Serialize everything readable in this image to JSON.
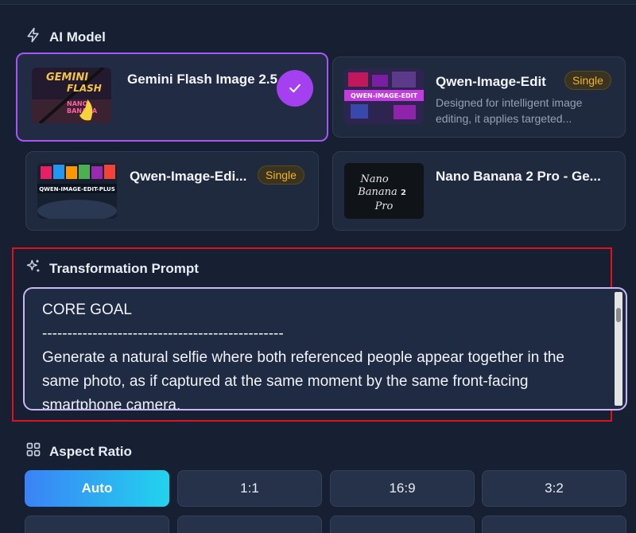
{
  "ai_model": {
    "label": "AI Model",
    "cards": [
      {
        "title": "Gemini Flash Image 2.5",
        "selected": true
      },
      {
        "title": "Qwen-Image-Edit",
        "badge": "Single",
        "description": "Designed for intelligent image editing, it applies targeted..."
      },
      {
        "title": "Qwen-Image-Edi...",
        "badge": "Single"
      },
      {
        "title": "Nano Banana 2 Pro - Ge..."
      }
    ],
    "thumb_texts": {
      "gemini": [
        "GEMINI",
        "FLASH",
        "NANO",
        "BANANA"
      ],
      "qwen_edit": "QWEN-IMAGE-EDIT",
      "qwen_plus": "QWEN-IMAGE-EDIT-PLUS",
      "nano": [
        "Nano",
        "Banana",
        "2",
        "Pro"
      ]
    }
  },
  "prompt": {
    "label": "Transformation Prompt",
    "text": "CORE GOAL\n------------------------------------------------\nGenerate a natural selfie where both referenced people appear together in the same photo, as if captured at the same moment by the same front-facing smartphone camera."
  },
  "aspect_ratio": {
    "label": "Aspect Ratio",
    "options": [
      "Auto",
      "1:1",
      "16:9",
      "3:2"
    ],
    "selected": "Auto"
  },
  "colors": {
    "accent_purple": "#a855f7",
    "badge_gold": "#f0b429",
    "active_gradient_start": "#3b82f6",
    "active_gradient_end": "#22d3ee"
  }
}
